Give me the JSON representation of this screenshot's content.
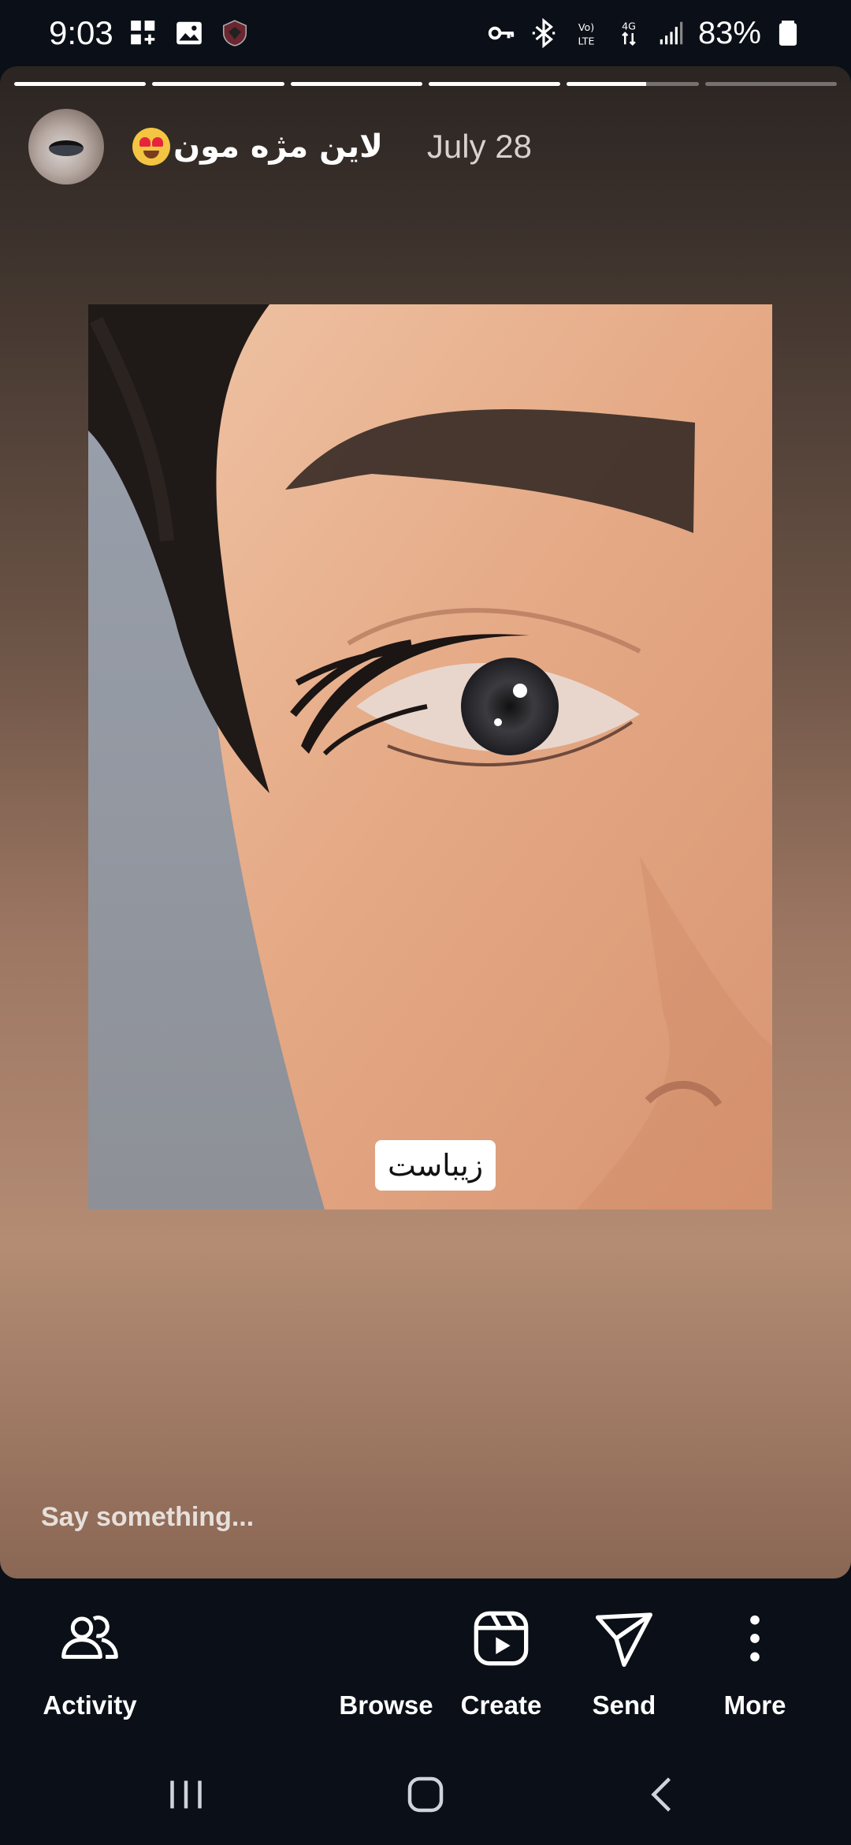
{
  "status_bar": {
    "time": "9:03",
    "battery": "83%",
    "icons": [
      "dashboard-plus-icon",
      "gallery-icon",
      "app-shield-icon",
      "key-icon",
      "bluetooth-icon",
      "volte-icon",
      "4g-data-icon",
      "signal-icon",
      "battery-icon"
    ]
  },
  "story": {
    "progress": [
      1,
      1,
      1,
      1,
      0.6,
      0
    ],
    "username": "لاین مژه مون",
    "date": "July 28",
    "sticker_text": "زیباست",
    "reply_placeholder": "Say something..."
  },
  "actions": {
    "activity": "Activity",
    "browse": "Browse",
    "create": "Create",
    "send": "Send",
    "more": "More"
  },
  "colors": {
    "background": "#0b0f17",
    "story_top": "#2b2522",
    "story_bottom": "#b48c74"
  }
}
